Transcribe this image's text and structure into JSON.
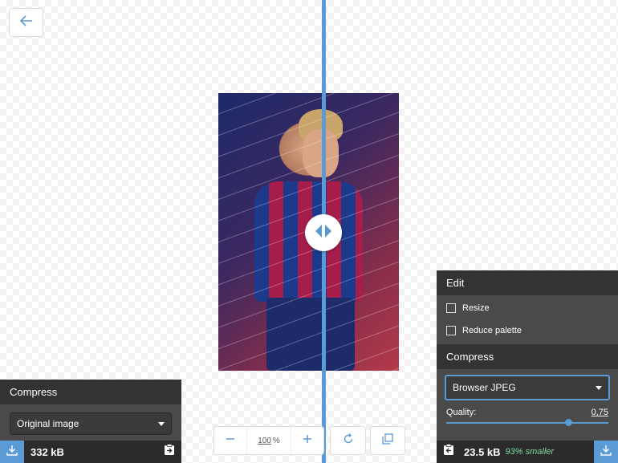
{
  "left_panel": {
    "header": "Compress",
    "method_selected": "Original image",
    "size": "332 kB"
  },
  "right_panel": {
    "edit_header": "Edit",
    "resize_label": "Resize",
    "reduce_palette_label": "Reduce palette",
    "compress_header": "Compress",
    "method_selected": "Browser JPEG",
    "quality_label": "Quality:",
    "quality_value": "0,75",
    "quality_fraction": 0.75,
    "size": "23.5 kB",
    "savings": "93% smaller"
  },
  "toolbar": {
    "zoom_value": "100",
    "zoom_unit": "%"
  },
  "colors": {
    "accent": "#5b9bd5",
    "panel": "#4a4a4a",
    "savings_text": "#7fd6a0"
  },
  "icons": [
    "back-arrow-icon",
    "zoom-out-icon",
    "zoom-in-icon",
    "rotate-icon",
    "background-toggle-icon",
    "download-icon",
    "copy-settings-icon",
    "split-handle-icon"
  ]
}
